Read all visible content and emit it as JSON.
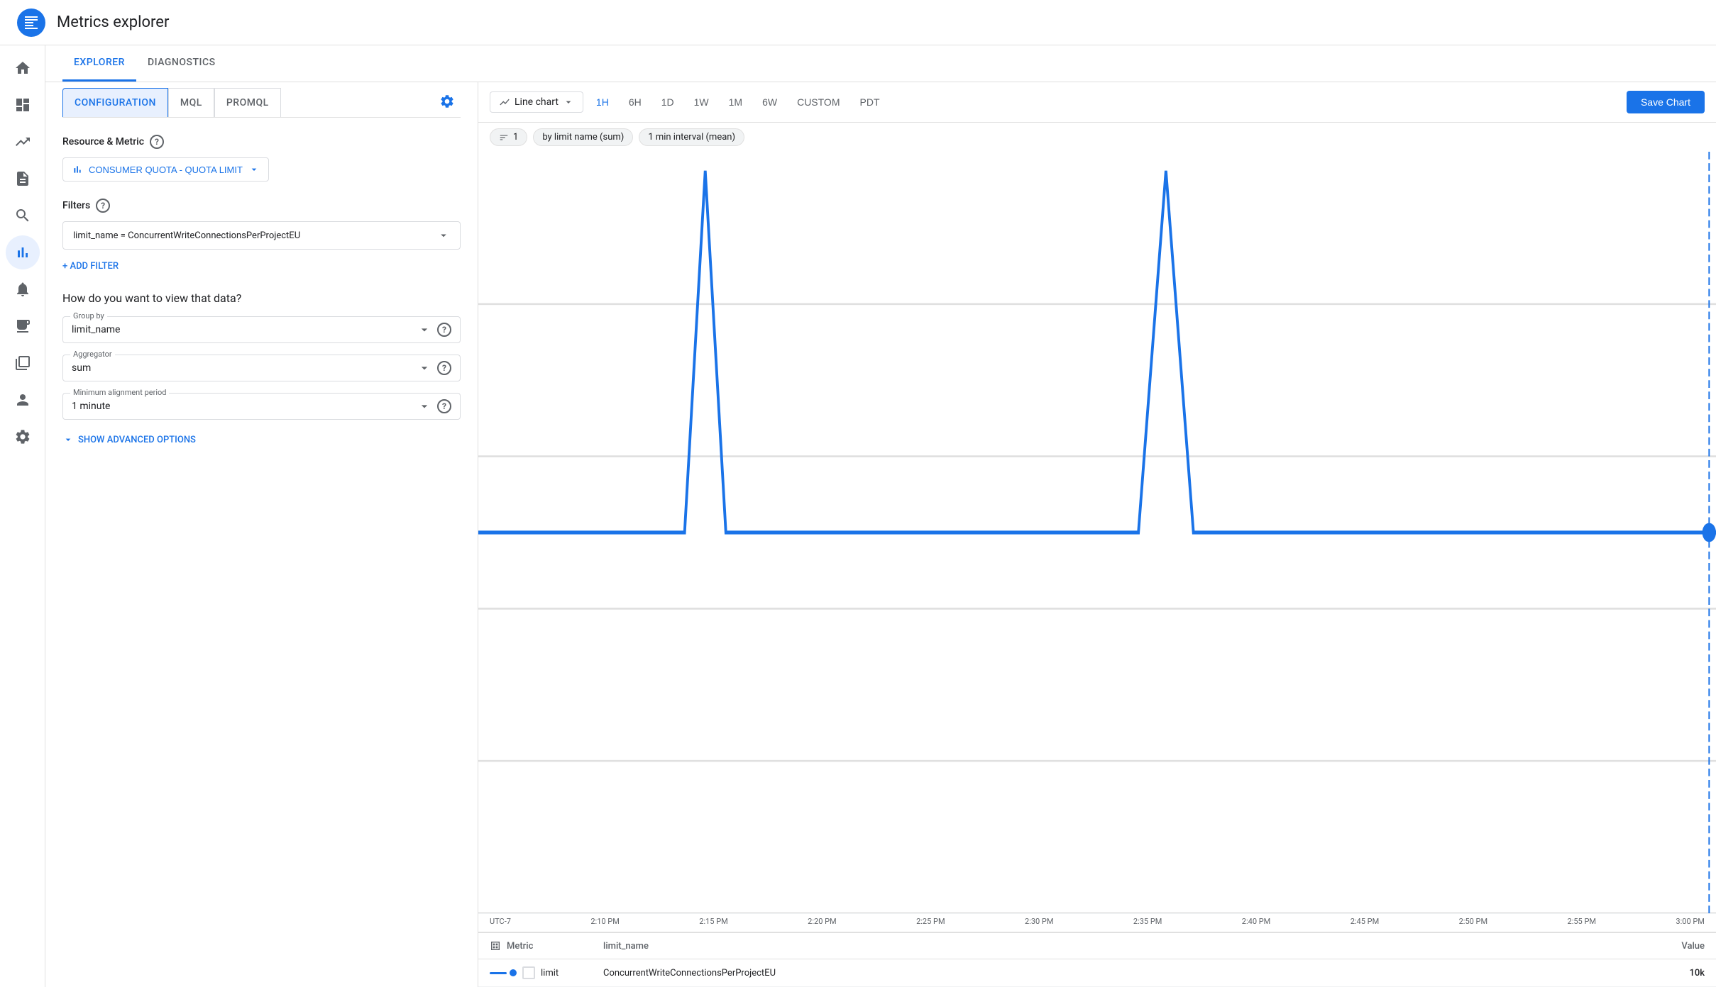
{
  "app": {
    "title": "Metrics explorer"
  },
  "top_tabs": {
    "items": [
      {
        "id": "explorer",
        "label": "EXPLORER",
        "active": true
      },
      {
        "id": "diagnostics",
        "label": "DIAGNOSTICS",
        "active": false
      }
    ]
  },
  "sub_tabs": {
    "items": [
      {
        "id": "configuration",
        "label": "CONFIGURATION",
        "active": true
      },
      {
        "id": "mql",
        "label": "MQL",
        "active": false
      },
      {
        "id": "promql",
        "label": "PROMQL",
        "active": false
      }
    ]
  },
  "resource_metric": {
    "section_label": "Resource & Metric",
    "button_label": "CONSUMER QUOTA - QUOTA LIMIT"
  },
  "filters": {
    "section_label": "Filters",
    "active_filter": "limit_name = ConcurrentWriteConnectionsPerProjectEU",
    "add_filter_label": "+ ADD FILTER"
  },
  "view": {
    "question": "How do you want to view that data?",
    "group_by": {
      "label": "Group by",
      "value": "limit_name"
    },
    "aggregator": {
      "label": "Aggregator",
      "value": "sum"
    },
    "alignment": {
      "label": "Minimum alignment period",
      "value": "1 minute"
    },
    "show_advanced": "SHOW ADVANCED OPTIONS"
  },
  "chart": {
    "type": "Line chart",
    "time_buttons": [
      {
        "label": "1H",
        "active": true
      },
      {
        "label": "6H",
        "active": false
      },
      {
        "label": "1D",
        "active": false
      },
      {
        "label": "1W",
        "active": false
      },
      {
        "label": "1M",
        "active": false
      },
      {
        "label": "6W",
        "active": false
      },
      {
        "label": "CUSTOM",
        "active": false
      },
      {
        "label": "PDT",
        "active": false
      }
    ],
    "save_label": "Save Chart",
    "legend_chips": [
      {
        "label": "1",
        "icon": "filter"
      },
      {
        "label": "by limit name (sum)"
      },
      {
        "label": "1 min interval (mean)"
      }
    ],
    "x_axis": [
      "UTC-7",
      "2:10 PM",
      "2:15 PM",
      "2:20 PM",
      "2:25 PM",
      "2:30 PM",
      "2:35 PM",
      "2:40 PM",
      "2:45 PM",
      "2:50 PM",
      "2:55 PM",
      "3:00 PM"
    ]
  },
  "data_table": {
    "columns": [
      "Metric",
      "limit_name",
      "Value"
    ],
    "rows": [
      {
        "metric_label": "limit",
        "limit_name": "ConcurrentWriteConnectionsPerProjectEU",
        "value": "10k"
      }
    ]
  },
  "nav": {
    "items": [
      {
        "id": "dashboard",
        "icon": "dashboard",
        "active": false
      },
      {
        "id": "metrics",
        "icon": "metrics",
        "active": false
      },
      {
        "id": "logs",
        "icon": "logs",
        "active": false
      },
      {
        "id": "trace",
        "icon": "trace",
        "active": false
      },
      {
        "id": "profiler",
        "icon": "profiler",
        "active": false
      },
      {
        "id": "chart-active",
        "icon": "chart",
        "active": true
      },
      {
        "id": "alerts",
        "icon": "alerts",
        "active": false
      },
      {
        "id": "monitor",
        "icon": "monitor",
        "active": false
      },
      {
        "id": "groups",
        "icon": "groups",
        "active": false
      },
      {
        "id": "person",
        "icon": "person",
        "active": false
      },
      {
        "id": "settings",
        "icon": "settings",
        "active": false
      }
    ]
  }
}
